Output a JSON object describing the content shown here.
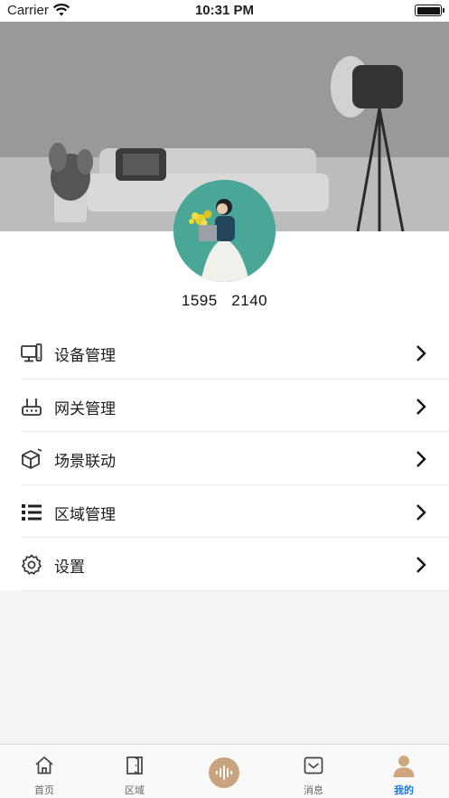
{
  "status_bar": {
    "carrier": "Carrier",
    "time": "10:31 PM"
  },
  "profile": {
    "phone": "1595    2140"
  },
  "menu": [
    {
      "label": "设备管理",
      "icon": "device-monitor-icon"
    },
    {
      "label": "网关管理",
      "icon": "gateway-router-icon"
    },
    {
      "label": "场景联动",
      "icon": "scene-cube-icon"
    },
    {
      "label": "区域管理",
      "icon": "list-icon"
    },
    {
      "label": "设置",
      "icon": "gear-icon"
    }
  ],
  "tabs": [
    {
      "label": "首页",
      "icon": "home-icon"
    },
    {
      "label": "区域",
      "icon": "door-icon"
    },
    {
      "label": "",
      "icon": "voice-wave-icon"
    },
    {
      "label": "消息",
      "icon": "message-tray-icon"
    },
    {
      "label": "我的",
      "icon": "person-icon",
      "active": true
    }
  ],
  "colors": {
    "accent": "#1d7bd8",
    "voice_button": "#c9a37f",
    "profile_icon": "#d0a67f"
  }
}
